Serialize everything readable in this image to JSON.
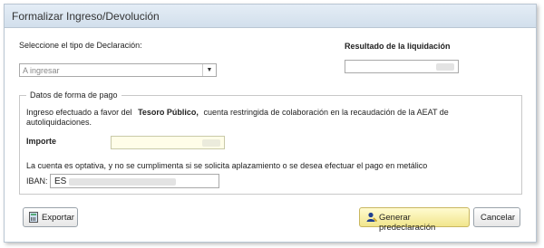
{
  "window": {
    "title": "Formalizar Ingreso/Devolución"
  },
  "declaration": {
    "label": "Seleccione el tipo de Declaración:",
    "selected": "A ingresar"
  },
  "result": {
    "label": "Resultado de la liquidación"
  },
  "payment": {
    "legend": "Datos de forma de pago",
    "text_prefix": "Ingreso efectuado a favor del",
    "text_bold": "Tesoro Público,",
    "text_suffix": "cuenta restringida de colaboración en la recaudación de la AEAT de",
    "text_line2": "autoliquidaciones.",
    "importe_label": "Importe",
    "optional_note": "La cuenta es optativa, y no se cumplimenta si se solicita aplazamiento o se desea efectuar el pago en metálico",
    "iban_label": "IBAN:",
    "iban_value": "ES"
  },
  "buttons": {
    "export": "Exportar",
    "generate": "Generar predeclaración",
    "cancel": "Cancelar"
  },
  "icons": {
    "export": "calculator-icon",
    "generate": "user-icon",
    "dropdown": "chevron-down-icon"
  }
}
